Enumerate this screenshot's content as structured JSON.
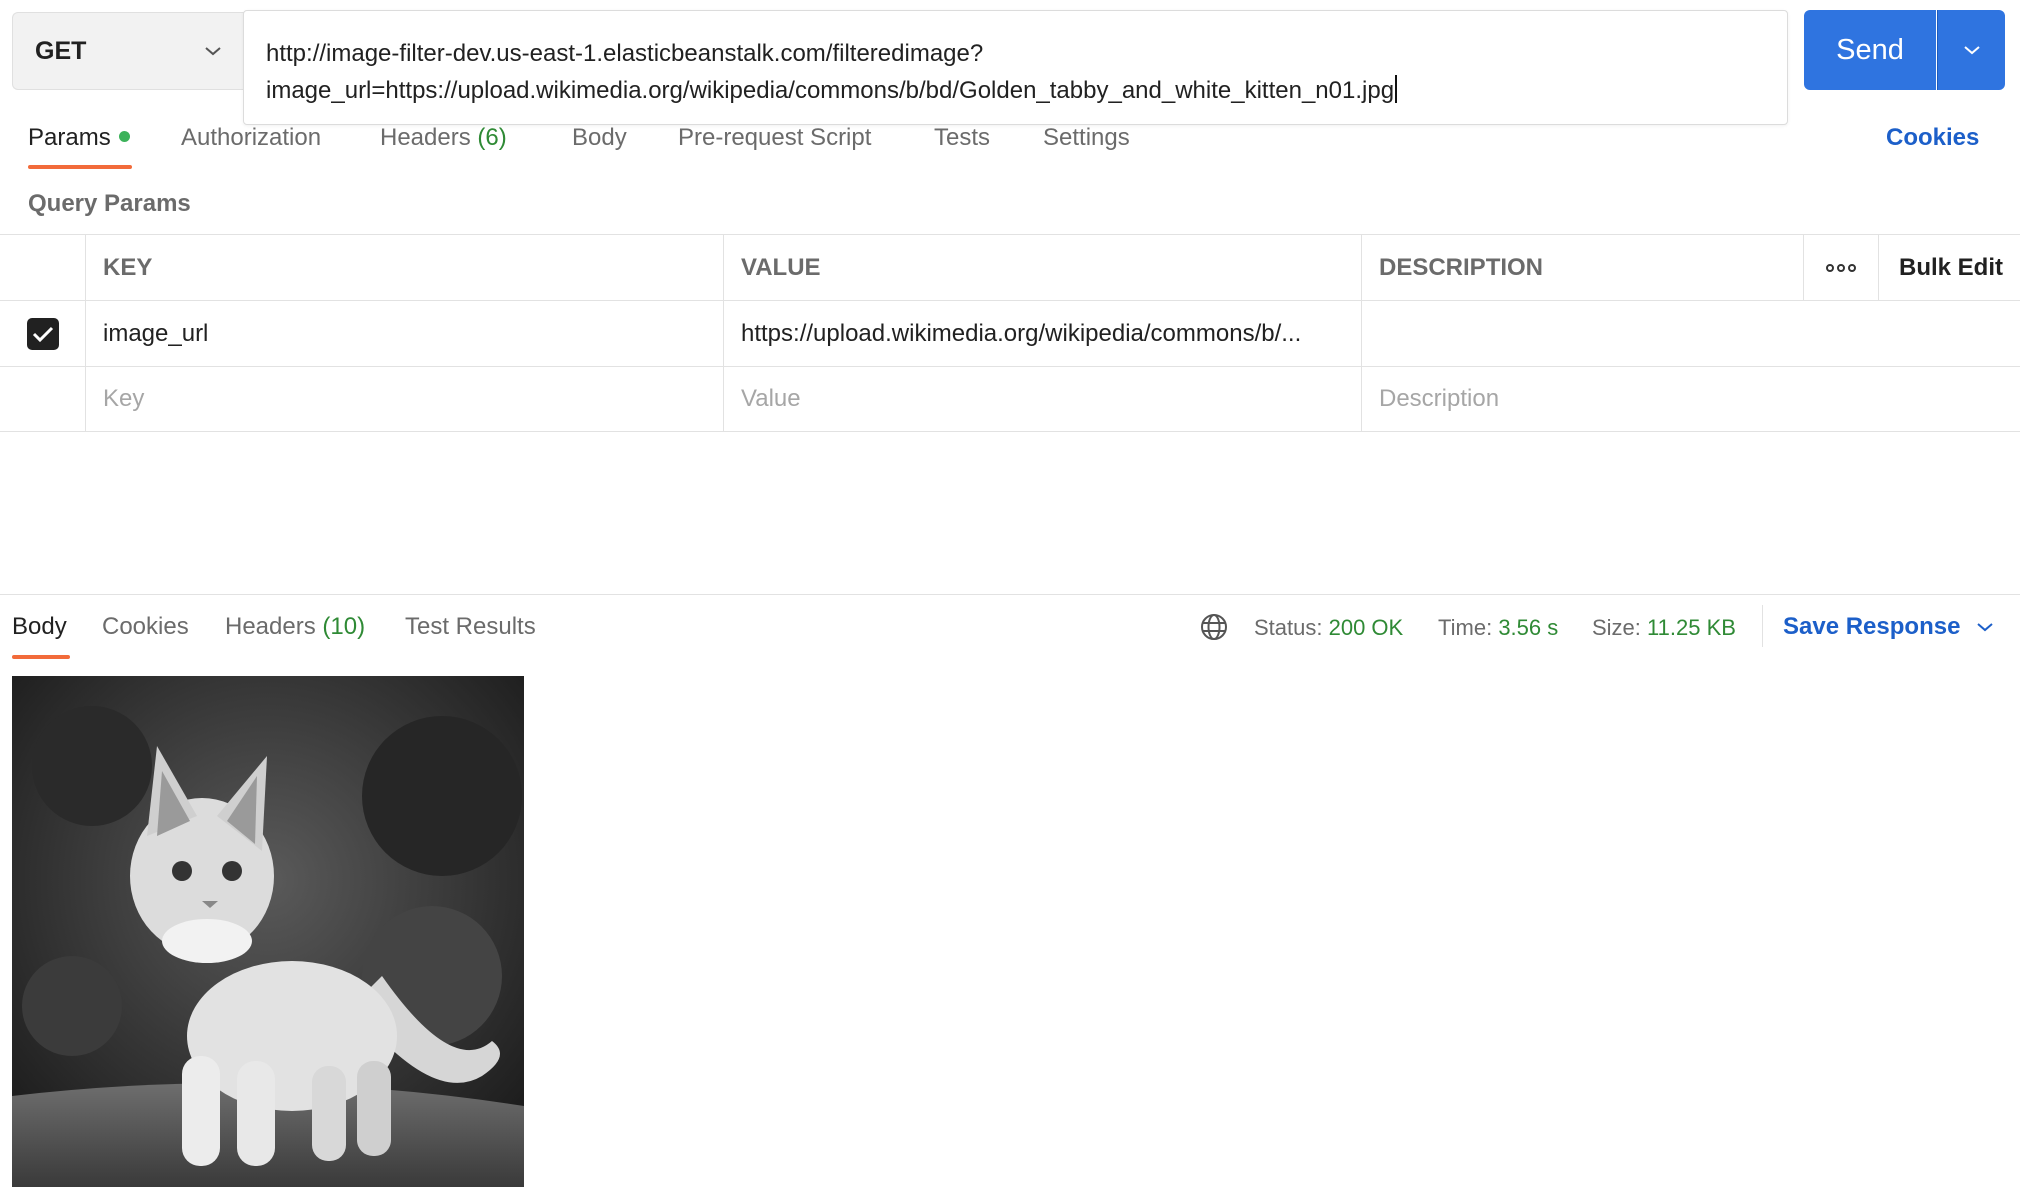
{
  "request": {
    "method": "GET",
    "url_line1": "http://image-filter-dev.us-east-1.elasticbeanstalk.com/filteredimage?",
    "url_line2": "image_url=https://upload.wikimedia.org/wikipedia/commons/b/bd/Golden_tabby_and_white_kitten_n01.jpg",
    "send_label": "Send"
  },
  "request_tabs": {
    "params": "Params",
    "authorization": "Authorization",
    "headers": "Headers",
    "headers_count": "(6)",
    "body": "Body",
    "pre_request": "Pre-request Script",
    "tests": "Tests",
    "settings": "Settings",
    "cookies": "Cookies"
  },
  "query_params": {
    "title": "Query Params",
    "columns": {
      "key": "KEY",
      "value": "VALUE",
      "description": "DESCRIPTION",
      "bulk_edit": "Bulk Edit"
    },
    "rows": [
      {
        "checked": true,
        "key": "image_url",
        "value": "https://upload.wikimedia.org/wikipedia/commons/b/...",
        "description": ""
      }
    ],
    "placeholders": {
      "key": "Key",
      "value": "Value",
      "description": "Description"
    }
  },
  "response_tabs": {
    "body": "Body",
    "cookies": "Cookies",
    "headers": "Headers",
    "headers_count": "(10)",
    "test_results": "Test Results"
  },
  "response_meta": {
    "status_label": "Status:",
    "status_value": "200 OK",
    "time_label": "Time:",
    "time_value": "3.56 s",
    "size_label": "Size:",
    "size_value": "11.25 KB",
    "save_response": "Save Response"
  },
  "colors": {
    "accent_orange": "#f26b3a",
    "primary_blue": "#2f74e0",
    "success_green": "#2f8a35",
    "link_blue": "#1c5fc9"
  },
  "icons": {
    "method_dropdown": "chevron-down-icon",
    "send_dropdown": "chevron-down-icon",
    "params_indicator": "green-dot",
    "more": "more-horizontal-icon",
    "network": "globe-icon",
    "save_dropdown": "chevron-down-icon"
  }
}
